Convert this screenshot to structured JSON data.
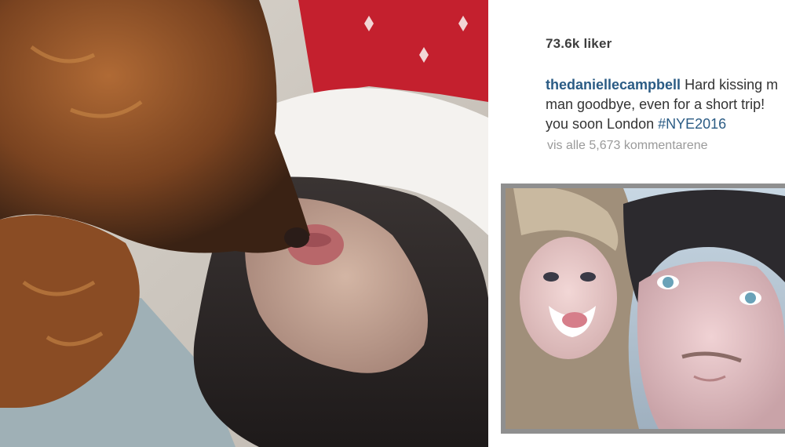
{
  "post": {
    "likes": "73.6k liker",
    "caption": {
      "username": "thedaniellecampbell",
      "line1_text": " Hard kissing m",
      "line2_text": "man goodbye, even for a short trip! ",
      "line3_text": "you soon London ",
      "hashtag": "#NYE2016"
    },
    "view_comments": "vis alle 5,673 kommentarene"
  },
  "colors": {
    "username": "#2a5b84",
    "likes": "#3d3d3d",
    "muted": "#9a9a9a",
    "inset_border": "#8f8f8f"
  }
}
